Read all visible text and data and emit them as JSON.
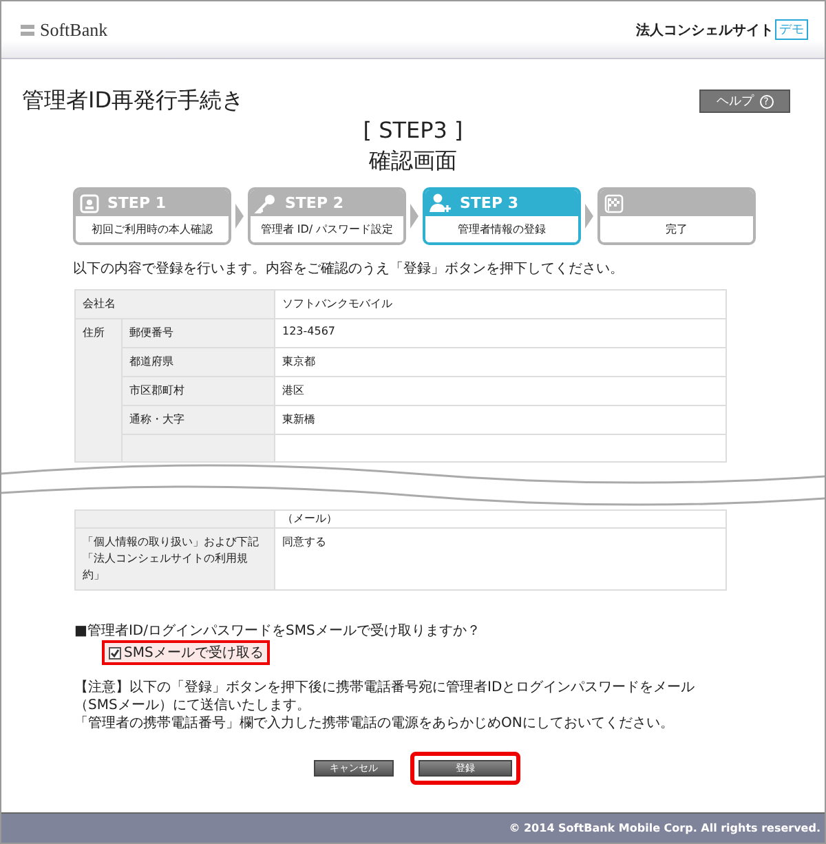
{
  "header": {
    "logo": "SoftBank",
    "site_name": "法人コンシェルサイト",
    "badge": "デモ"
  },
  "title": "管理者ID再発行手続き",
  "help_button": {
    "label": "ヘルプ",
    "icon": "?"
  },
  "step_heading": "[ STEP3 ]",
  "subheading": "確認画面",
  "steps": [
    {
      "kind": "card",
      "title": "STEP 1",
      "label": "初回ご利用時の本人確認",
      "selected": false
    },
    {
      "kind": "key",
      "title": "STEP 2",
      "label": "管理者 ID/ パスワード設定",
      "selected": false
    },
    {
      "kind": "user",
      "title": "STEP 3",
      "label": "管理者情報の登録",
      "selected": true
    },
    {
      "kind": "flag",
      "label": "完了",
      "selected": false
    }
  ],
  "instruction": "以下の内容で登録を行います。内容をご確認のうえ「登録」ボタンを押下してください。",
  "table_top": [
    {
      "kind": "single",
      "label": "会社名",
      "value": "ソフトバンクモバイル"
    },
    {
      "kind": "group",
      "label": "住所",
      "rows": [
        {
          "label": "郵便番号",
          "value": "123-4567"
        },
        {
          "label": "都道府県",
          "value": "東京都"
        },
        {
          "label": "市区郡町村",
          "value": "港区"
        },
        {
          "label": "通称・大字",
          "value": "東新橋"
        }
      ]
    }
  ],
  "table_bottom": [
    {
      "kind": "fragment",
      "value": "（メール）"
    },
    {
      "kind": "single",
      "label": "「個人情報の取り扱い」および下記「法人コンシェルサイトの利用規約」",
      "value": "同意する"
    }
  ],
  "sms": {
    "question": "■管理者ID/ログインパスワードをSMSメールで受け取りますか？",
    "checkbox_label": "SMSメールで受け取る",
    "checked": true,
    "highlighted": true
  },
  "notes": [
    "【注意】以下の「登録」ボタンを押下後に携帯電話番号宛に管理者IDとログインパスワードをメール（SMSメール）にて送信いたします。",
    "「管理者の携帯電話番号」欄で入力した携帯電話の電源をあらかじめONにしておいてください。"
  ],
  "buttons": [
    {
      "label": "キャンセル",
      "highlighted": false
    },
    {
      "label": "登録",
      "highlighted": true
    }
  ],
  "footer": "© 2014 SoftBank Mobile Corp. All rights reserved."
}
